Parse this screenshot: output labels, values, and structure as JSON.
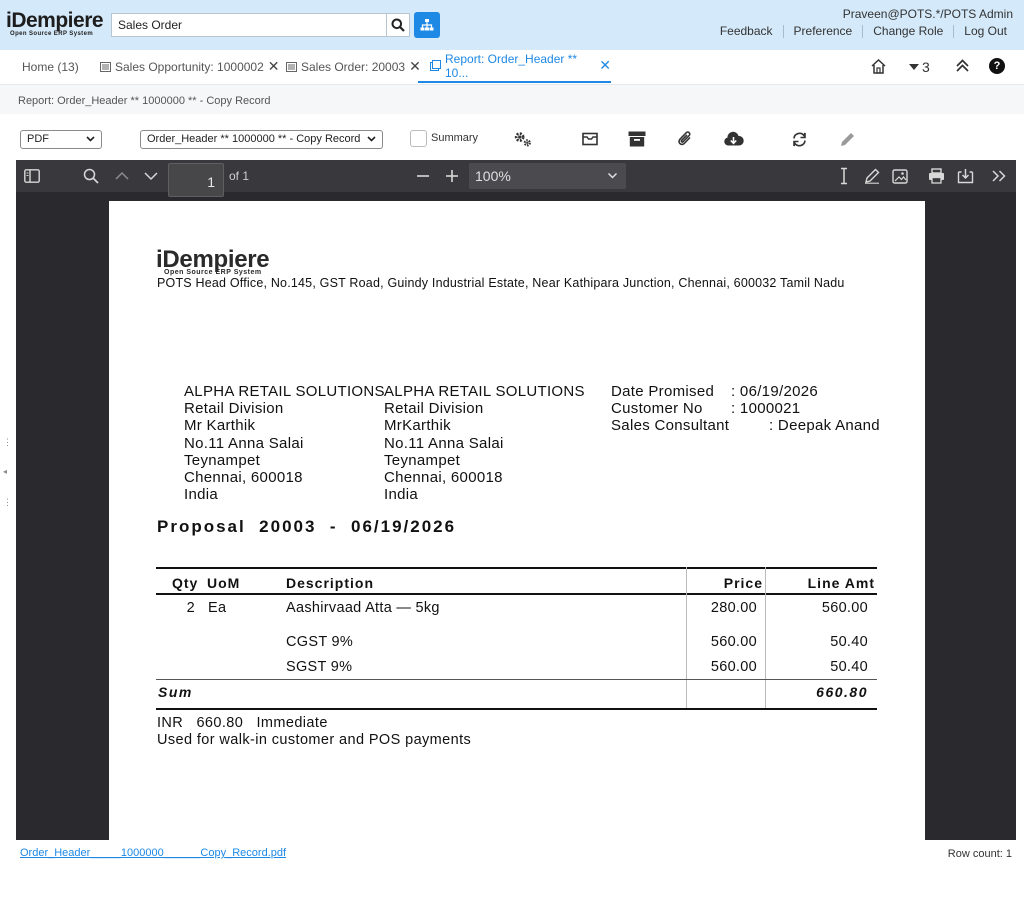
{
  "header": {
    "logo_title": "iDempiere",
    "logo_subtitle": "Open Source ERP System",
    "search_value": "Sales Order",
    "user": "Praveen@POTS.*/POTS Admin",
    "links": [
      "Feedback",
      "Preference",
      "Change Role",
      "Log Out"
    ]
  },
  "tabs": [
    {
      "label": "Home (13)"
    },
    {
      "label": "Sales Opportunity: 1000002"
    },
    {
      "label": "Sales Order: 20003"
    },
    {
      "label": "Report: Order_Header ** 10..."
    }
  ],
  "tab_tools": {
    "count": "3",
    "help": "?"
  },
  "breadcrumb": "Report: Order_Header ** 1000000 ** - Copy Record",
  "toolbar": {
    "format": "PDF",
    "report": "Order_Header ** 1000000 ** - Copy Record",
    "summary_label": "Summary"
  },
  "viewer": {
    "page": "1",
    "page_of": "of 1",
    "zoom": "100%"
  },
  "document": {
    "logo_title": "iDempiere",
    "logo_subtitle": "Open Source ERP System",
    "org_address": "POTS Head Office, No.145, GST Road, Guindy Industrial Estate, Near Kathipara Junction, Chennai,  600032 Tamil Nadu",
    "bill_to": [
      "ALPHA RETAIL SOLUTIONS",
      "Retail Division",
      "Mr Karthik",
      "No.11 Anna Salai",
      "Teynampet",
      "Chennai,  600018",
      "India"
    ],
    "ship_to": [
      "ALPHA RETAIL SOLUTIONS",
      "Retail Division",
      "MrKarthik",
      "No.11 Anna Salai",
      "Teynampet",
      "Chennai,  600018",
      "India"
    ],
    "info": [
      {
        "label": "Date Promised",
        "value": ": 06/19/2026"
      },
      {
        "label": "Customer No",
        "value": ": 1000021"
      },
      {
        "label": "Sales Consultant",
        "value": ": Deepak Anand"
      }
    ],
    "heading": "Proposal  20003  -  06/19/2026",
    "columns": {
      "qty": "Qty",
      "uom": "UoM",
      "desc": "Description",
      "price": "Price",
      "amt": "Line Amt"
    },
    "lines": [
      {
        "qty": "2",
        "uom": "Ea",
        "desc": "Aashirvaad Atta — 5kg",
        "price": "280.00",
        "amt": "560.00"
      },
      {
        "qty": "",
        "uom": "",
        "desc": "CGST 9%",
        "price": "560.00",
        "amt": "50.40"
      },
      {
        "qty": "",
        "uom": "",
        "desc": "SGST 9%",
        "price": "560.00",
        "amt": "50.40"
      }
    ],
    "sum_label": "Sum",
    "sum_value": "660.80",
    "footer_line1": "INR   660.80   Immediate",
    "footer_line2": "Used for walk-in customer and POS payments"
  },
  "bottom": {
    "pdf_link": "Order_Header_____1000000______Copy_Record.pdf",
    "row_count": "Row count: 1"
  }
}
